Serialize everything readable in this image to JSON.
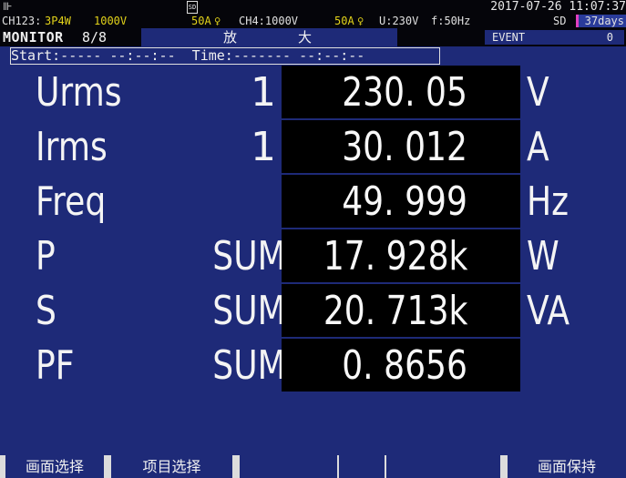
{
  "status": {
    "plug_glyph": "⊪",
    "sd_glyph": "SD",
    "datetime": "2017-07-26 11:07:37"
  },
  "info": {
    "ch123": "CH123:",
    "wiring": "3P4W",
    "ch123_range_v": "1000V",
    "ch123_range_a": "50A",
    "clamp_glyph": "♀",
    "ch4": "CH4:1000V",
    "ch4_range_a": "50A",
    "ch4_clamp_glyph": "♀",
    "u": "U:230V",
    "f": "f:50Hz",
    "sd": "SD",
    "days": "37days"
  },
  "mode": {
    "monitor": "MONITOR",
    "page": "8/8",
    "title_c1": "放",
    "title_c2": "大",
    "event_label": "EVENT",
    "event_count": "0"
  },
  "timebar": {
    "text": "Start:----- --:--:--  Time:------- --:--:--"
  },
  "rows": [
    {
      "name": "Urms",
      "channel": "1",
      "value": "230. 05",
      "unit": "V"
    },
    {
      "name": "Irms",
      "channel": "1",
      "value": "30. 012",
      "unit": "A"
    },
    {
      "name": "Freq",
      "channel": "",
      "value": "49. 999",
      "unit": "Hz"
    },
    {
      "name": "P",
      "channel": "SUM",
      "value": "17. 928k",
      "unit": "W"
    },
    {
      "name": "S",
      "channel": "SUM",
      "value": "20. 713k",
      "unit": "VA"
    },
    {
      "name": "PF",
      "channel": "SUM",
      "value": "0. 8656",
      "unit": ""
    }
  ],
  "fkeys": {
    "f1": "画面选择",
    "f2": "项目选择",
    "f3": "",
    "f4": "",
    "f5": "",
    "f6": "画面保持"
  }
}
